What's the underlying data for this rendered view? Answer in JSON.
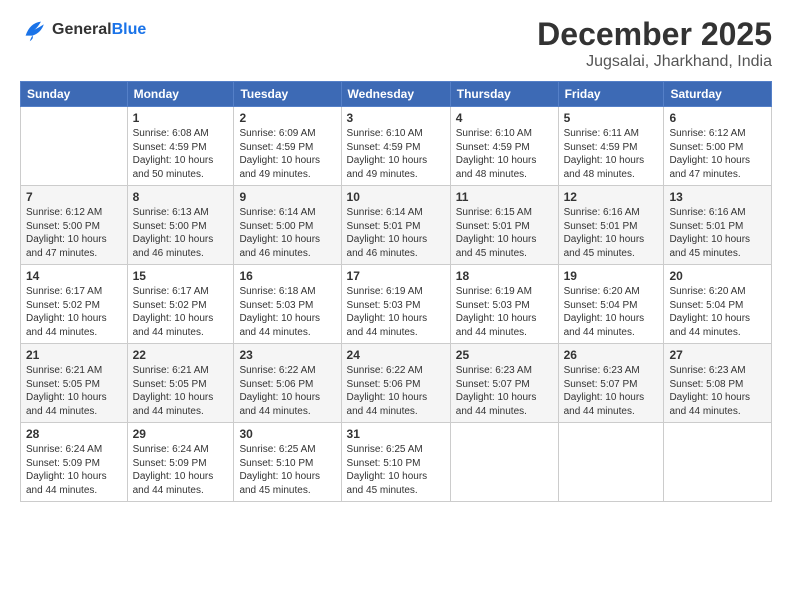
{
  "logo": {
    "general": "General",
    "blue": "Blue"
  },
  "header": {
    "month": "December 2025",
    "location": "Jugsalai, Jharkhand, India"
  },
  "days_of_week": [
    "Sunday",
    "Monday",
    "Tuesday",
    "Wednesday",
    "Thursday",
    "Friday",
    "Saturday"
  ],
  "weeks": [
    [
      {
        "day": "",
        "sunrise": "",
        "sunset": "",
        "daylight": ""
      },
      {
        "day": "1",
        "sunrise": "Sunrise: 6:08 AM",
        "sunset": "Sunset: 4:59 PM",
        "daylight": "Daylight: 10 hours and 50 minutes."
      },
      {
        "day": "2",
        "sunrise": "Sunrise: 6:09 AM",
        "sunset": "Sunset: 4:59 PM",
        "daylight": "Daylight: 10 hours and 49 minutes."
      },
      {
        "day": "3",
        "sunrise": "Sunrise: 6:10 AM",
        "sunset": "Sunset: 4:59 PM",
        "daylight": "Daylight: 10 hours and 49 minutes."
      },
      {
        "day": "4",
        "sunrise": "Sunrise: 6:10 AM",
        "sunset": "Sunset: 4:59 PM",
        "daylight": "Daylight: 10 hours and 48 minutes."
      },
      {
        "day": "5",
        "sunrise": "Sunrise: 6:11 AM",
        "sunset": "Sunset: 4:59 PM",
        "daylight": "Daylight: 10 hours and 48 minutes."
      },
      {
        "day": "6",
        "sunrise": "Sunrise: 6:12 AM",
        "sunset": "Sunset: 5:00 PM",
        "daylight": "Daylight: 10 hours and 47 minutes."
      }
    ],
    [
      {
        "day": "7",
        "sunrise": "Sunrise: 6:12 AM",
        "sunset": "Sunset: 5:00 PM",
        "daylight": "Daylight: 10 hours and 47 minutes."
      },
      {
        "day": "8",
        "sunrise": "Sunrise: 6:13 AM",
        "sunset": "Sunset: 5:00 PM",
        "daylight": "Daylight: 10 hours and 46 minutes."
      },
      {
        "day": "9",
        "sunrise": "Sunrise: 6:14 AM",
        "sunset": "Sunset: 5:00 PM",
        "daylight": "Daylight: 10 hours and 46 minutes."
      },
      {
        "day": "10",
        "sunrise": "Sunrise: 6:14 AM",
        "sunset": "Sunset: 5:01 PM",
        "daylight": "Daylight: 10 hours and 46 minutes."
      },
      {
        "day": "11",
        "sunrise": "Sunrise: 6:15 AM",
        "sunset": "Sunset: 5:01 PM",
        "daylight": "Daylight: 10 hours and 45 minutes."
      },
      {
        "day": "12",
        "sunrise": "Sunrise: 6:16 AM",
        "sunset": "Sunset: 5:01 PM",
        "daylight": "Daylight: 10 hours and 45 minutes."
      },
      {
        "day": "13",
        "sunrise": "Sunrise: 6:16 AM",
        "sunset": "Sunset: 5:01 PM",
        "daylight": "Daylight: 10 hours and 45 minutes."
      }
    ],
    [
      {
        "day": "14",
        "sunrise": "Sunrise: 6:17 AM",
        "sunset": "Sunset: 5:02 PM",
        "daylight": "Daylight: 10 hours and 44 minutes."
      },
      {
        "day": "15",
        "sunrise": "Sunrise: 6:17 AM",
        "sunset": "Sunset: 5:02 PM",
        "daylight": "Daylight: 10 hours and 44 minutes."
      },
      {
        "day": "16",
        "sunrise": "Sunrise: 6:18 AM",
        "sunset": "Sunset: 5:03 PM",
        "daylight": "Daylight: 10 hours and 44 minutes."
      },
      {
        "day": "17",
        "sunrise": "Sunrise: 6:19 AM",
        "sunset": "Sunset: 5:03 PM",
        "daylight": "Daylight: 10 hours and 44 minutes."
      },
      {
        "day": "18",
        "sunrise": "Sunrise: 6:19 AM",
        "sunset": "Sunset: 5:03 PM",
        "daylight": "Daylight: 10 hours and 44 minutes."
      },
      {
        "day": "19",
        "sunrise": "Sunrise: 6:20 AM",
        "sunset": "Sunset: 5:04 PM",
        "daylight": "Daylight: 10 hours and 44 minutes."
      },
      {
        "day": "20",
        "sunrise": "Sunrise: 6:20 AM",
        "sunset": "Sunset: 5:04 PM",
        "daylight": "Daylight: 10 hours and 44 minutes."
      }
    ],
    [
      {
        "day": "21",
        "sunrise": "Sunrise: 6:21 AM",
        "sunset": "Sunset: 5:05 PM",
        "daylight": "Daylight: 10 hours and 44 minutes."
      },
      {
        "day": "22",
        "sunrise": "Sunrise: 6:21 AM",
        "sunset": "Sunset: 5:05 PM",
        "daylight": "Daylight: 10 hours and 44 minutes."
      },
      {
        "day": "23",
        "sunrise": "Sunrise: 6:22 AM",
        "sunset": "Sunset: 5:06 PM",
        "daylight": "Daylight: 10 hours and 44 minutes."
      },
      {
        "day": "24",
        "sunrise": "Sunrise: 6:22 AM",
        "sunset": "Sunset: 5:06 PM",
        "daylight": "Daylight: 10 hours and 44 minutes."
      },
      {
        "day": "25",
        "sunrise": "Sunrise: 6:23 AM",
        "sunset": "Sunset: 5:07 PM",
        "daylight": "Daylight: 10 hours and 44 minutes."
      },
      {
        "day": "26",
        "sunrise": "Sunrise: 6:23 AM",
        "sunset": "Sunset: 5:07 PM",
        "daylight": "Daylight: 10 hours and 44 minutes."
      },
      {
        "day": "27",
        "sunrise": "Sunrise: 6:23 AM",
        "sunset": "Sunset: 5:08 PM",
        "daylight": "Daylight: 10 hours and 44 minutes."
      }
    ],
    [
      {
        "day": "28",
        "sunrise": "Sunrise: 6:24 AM",
        "sunset": "Sunset: 5:09 PM",
        "daylight": "Daylight: 10 hours and 44 minutes."
      },
      {
        "day": "29",
        "sunrise": "Sunrise: 6:24 AM",
        "sunset": "Sunset: 5:09 PM",
        "daylight": "Daylight: 10 hours and 44 minutes."
      },
      {
        "day": "30",
        "sunrise": "Sunrise: 6:25 AM",
        "sunset": "Sunset: 5:10 PM",
        "daylight": "Daylight: 10 hours and 45 minutes."
      },
      {
        "day": "31",
        "sunrise": "Sunrise: 6:25 AM",
        "sunset": "Sunset: 5:10 PM",
        "daylight": "Daylight: 10 hours and 45 minutes."
      },
      {
        "day": "",
        "sunrise": "",
        "sunset": "",
        "daylight": ""
      },
      {
        "day": "",
        "sunrise": "",
        "sunset": "",
        "daylight": ""
      },
      {
        "day": "",
        "sunrise": "",
        "sunset": "",
        "daylight": ""
      }
    ]
  ]
}
